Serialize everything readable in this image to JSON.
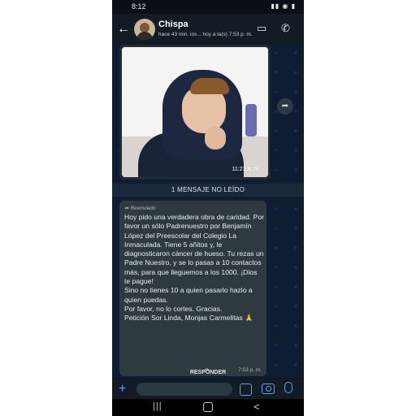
{
  "statusbar": {
    "time": "8:12",
    "icons": "▮▮ ◉ ▮"
  },
  "header": {
    "back_icon": "←",
    "name": "Chispa",
    "status": "hace 43 min. ios... hoy a la(s) 7:53 p. m.",
    "video_icon": "▭",
    "call_icon": "✆"
  },
  "media_message": {
    "time": "11:21 a. m."
  },
  "unread_banner": "1 MENSAJE NO LEÍDO",
  "text_message": {
    "forwarded_label": "Reenviado",
    "body": "Hoy pido una verdadera obra de caridad. Por favor un sólo Padrenuestro por Benjamín López del Preescolar del Colegio La Inmaculada. Tiene 5 añitos y, le diagnosticaron cáncer de hueso. Tu rezas un Padre Nuestro, y se lo pasas a 10 contactos más, para que lleguemos a los 1000. ¡Dios te pague!\nSino no tienes 10 a quien pasarlo hazlo a quien puedas.\nPor favor, no lo cortes. Gracias.\nPetición Sor Linda, Monjas Carmelitas 🙏",
    "time": "7:53 p. m."
  },
  "reply_hint": "RESPONDER",
  "composer": {
    "plus_icon": "+"
  },
  "navbar": {
    "recent": "|||",
    "back": "<"
  },
  "colors": {
    "accent": "#4fa3ff",
    "chat_bg": "#0f1d33",
    "bubble": "#2f3a40"
  }
}
